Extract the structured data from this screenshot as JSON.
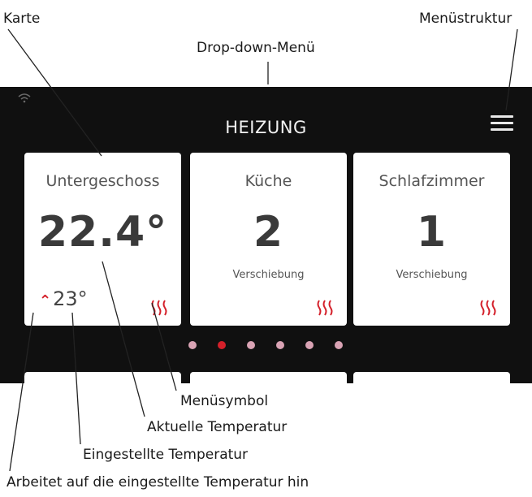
{
  "callouts": {
    "karte": "Karte",
    "dropdown": "Drop-down-Menü",
    "menustruktur": "Menüstruktur",
    "menusymbol": "Menüsymbol",
    "aktuelle_temp": "Aktuelle Temperatur",
    "eingestellte_temp": "Eingestellte Temperatur",
    "arbeitet": "Arbeitet auf die eingestellte Temperatur hin"
  },
  "screen": {
    "title": "HEIZUNG",
    "icons": {
      "wifi": "wifi-icon",
      "menu": "hamburger-menu-icon",
      "heat": "heating-waves-icon",
      "up": "double-chevron-up-icon"
    },
    "cards": [
      {
        "name": "Untergeschoss",
        "value": "22.4°",
        "setpoint": "23°",
        "sub": ""
      },
      {
        "name": "Küche",
        "value": "2",
        "setpoint": "",
        "sub": "Verschiebung"
      },
      {
        "name": "Schlafzimmer",
        "value": "1",
        "setpoint": "",
        "sub": "Verschiebung"
      }
    ],
    "pagination": {
      "count": 6,
      "active": 1
    },
    "colors": {
      "background": "#101010",
      "card": "#ffffff",
      "accent": "#d4202a",
      "dot": "#d9a3b4"
    }
  }
}
